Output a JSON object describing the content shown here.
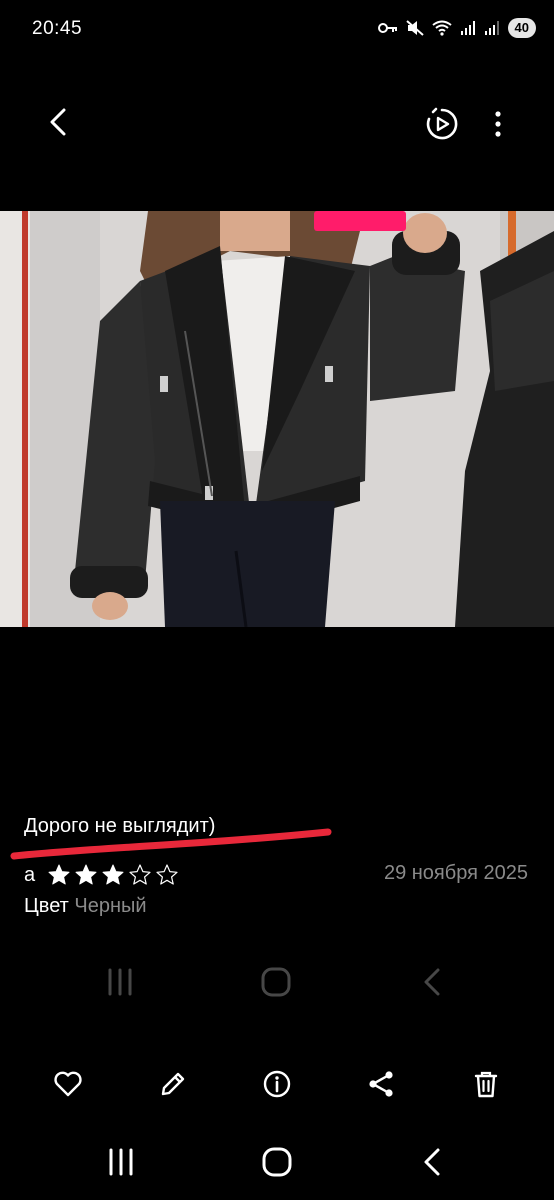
{
  "status_bar": {
    "time": "20:45",
    "icons": [
      "key-icon",
      "mute-icon",
      "wifi-icon",
      "signal-icon",
      "signal-icon"
    ],
    "battery": "40"
  },
  "top_bar": {
    "back_icon": "chevron-left-icon",
    "motion_icon": "motion-photo-icon",
    "more_icon": "more-vertical-icon"
  },
  "review": {
    "title": "Дорого не выглядит)",
    "rating_prefix": "а",
    "rating": 3,
    "rating_max": 5,
    "date": "29 ноября 2025",
    "color_label": "Цвет",
    "color_value": "Черный"
  },
  "actions": [
    "heart-icon",
    "edit-icon",
    "info-icon",
    "share-icon",
    "trash-icon"
  ],
  "colors": {
    "background": "#000000",
    "secondary_text": "#8a8a8a",
    "annotation_red": "#e8283a",
    "phone_pink": "#ff1c6a"
  }
}
